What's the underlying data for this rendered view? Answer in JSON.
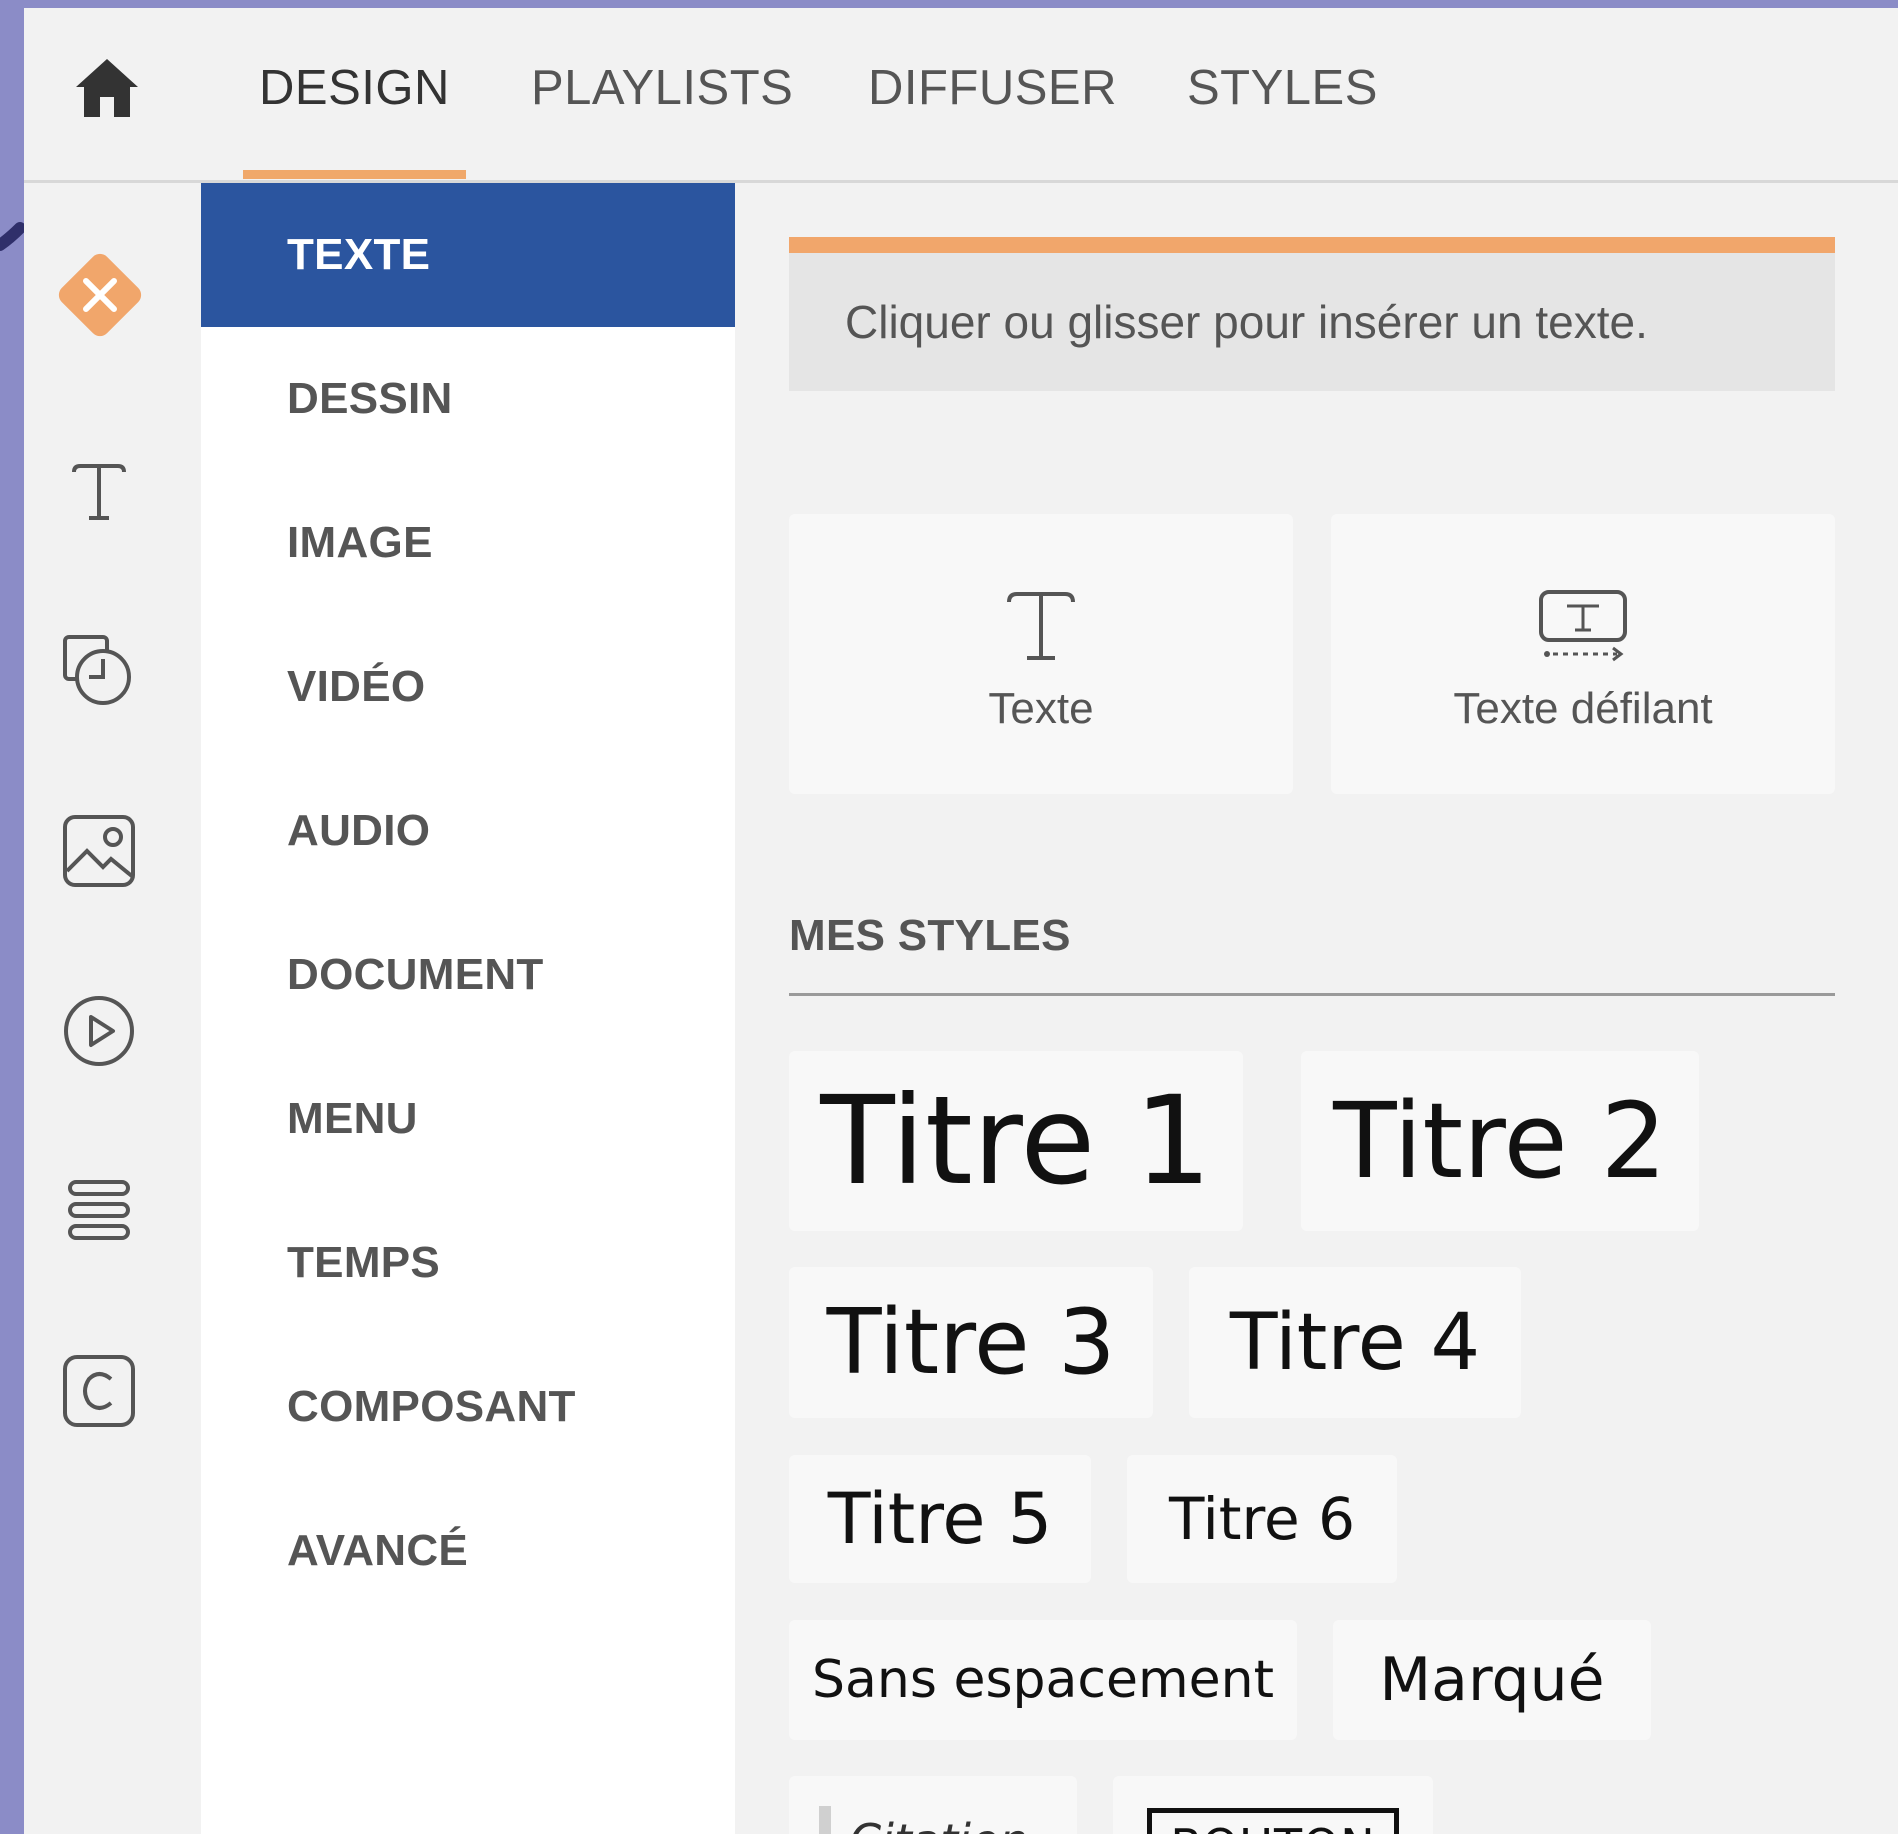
{
  "topnav": {
    "home_icon": "home-icon",
    "tabs": [
      {
        "label": "DESIGN",
        "active": true
      },
      {
        "label": "PLAYLISTS",
        "active": false
      },
      {
        "label": "DIFFUSER",
        "active": false
      },
      {
        "label": "STYLES",
        "active": false
      }
    ]
  },
  "rail": {
    "icons": [
      "close-icon",
      "text-icon",
      "shapes-icon",
      "image-icon",
      "play-icon",
      "menu-icon",
      "component-icon"
    ]
  },
  "categories": [
    {
      "label": "TEXTE",
      "active": true
    },
    {
      "label": "DESSIN",
      "active": false
    },
    {
      "label": "IMAGE",
      "active": false
    },
    {
      "label": "VIDÉO",
      "active": false
    },
    {
      "label": "AUDIO",
      "active": false
    },
    {
      "label": "DOCUMENT",
      "active": false
    },
    {
      "label": "MENU",
      "active": false
    },
    {
      "label": "TEMPS",
      "active": false
    },
    {
      "label": "COMPOSANT",
      "active": false
    },
    {
      "label": "AVANCÉ",
      "active": false
    }
  ],
  "content": {
    "hint": "Cliquer ou glisser pour insérer un texte.",
    "tools": [
      {
        "label": "Texte",
        "icon": "text-icon"
      },
      {
        "label": "Texte défilant",
        "icon": "scrolling-text-icon"
      }
    ],
    "section_title": "MES STYLES",
    "styles": [
      "Titre 1",
      "Titre 2",
      "Titre 3",
      "Titre 4",
      "Titre 5",
      "Titre 6",
      "Sans espacement",
      "Marqué",
      "Citation",
      "BOUTON"
    ]
  },
  "colors": {
    "accent": "#f0a86a",
    "active_category": "#2b559f",
    "background": "#8b8cc7"
  }
}
